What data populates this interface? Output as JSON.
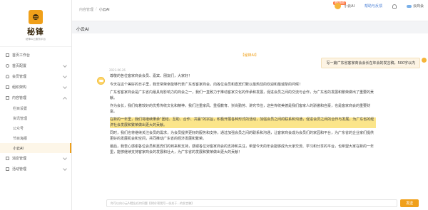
{
  "brand": {
    "title": "秘锋",
    "subtitle": "秘锋AI云服务平台"
  },
  "sidebar": {
    "items": [
      {
        "label": "首页工作台",
        "type": "item"
      },
      {
        "label": "首页配置",
        "type": "expandable"
      },
      {
        "label": "会员管理",
        "type": "expandable"
      },
      {
        "label": "组织架构",
        "type": "expandable"
      },
      {
        "label": "内容管理",
        "type": "expanded"
      },
      {
        "label": "栏目设置",
        "type": "sub"
      },
      {
        "label": "资讯管理",
        "type": "sub"
      },
      {
        "label": "公众号",
        "type": "sub"
      },
      {
        "label": "节目海报",
        "type": "sub"
      },
      {
        "label": "小云AI",
        "type": "sub-active"
      },
      {
        "label": "消息管理",
        "type": "expandable"
      },
      {
        "label": "活动管理",
        "type": "expandable"
      }
    ]
  },
  "topbar": {
    "breadcrumb": [
      "内容管理",
      "小云AI"
    ],
    "new_badge": "限时免费",
    "ai_label": "小云AI",
    "help_label": "帮助与反馈",
    "user_label": "云商会"
  },
  "page": {
    "title": "小云AI"
  },
  "chat": {
    "tag": "【秘锋AI】",
    "user_message": "写一篇广东省客家商会会长在年会的发言稿，500字以内",
    "time": "2023.06.26",
    "reply": [
      "尊敬的各位客家商会会员、嘉宾、朋友们，大家好！",
      "今天在这个美好的日子里，我非常荣幸能够代表广东省客家商会，向各位会员和嘉宾们致以最热忱的欢迎和最诚挚的问候！",
      "广东省客家商会是广东省内最具有影响力的商会之一，我们一直致力于推动客家文化的传承和发展，促进会员之间的交流与合作，为广东省的发展和繁荣做出了重要的贡献。",
      "作为会长，我们有着较好的优秀传统文化和精神，我们注重家风、重视教育、崇尚勤劳、讲究节俭，这些传统美德是我们客家人的骄傲和自豪，也是客家商会的重要财富。",
      "在新的一年里，我们将继续秉承“团结、互助、合作、共赢”的宗旨，积极开展各种形式的活动，加强会员之间的联系和沟通，促进会员之间的合作与发展，为广东省的经济社会发展和繁荣做出更大的贡献。",
      "同时，我们也将继续关注会员的需求，为会员提供更好的服务和支持，通过加强会员之间的联系和沟通，让客家商会成为会员们的家园和平台，为广东省的企业家们提供更好的发展机会和空间，共同推动广东省的经济发展和繁荣。",
      "最后，我衷心感谢各位会员和嘉宾们的到来和支持，感谢各位对客家商会的支持和关注，希望今天的年会能够成为大家交流、学习和分享的平台，也希望大家在新的一年里，能够继续支持客家商会的发展和壮大，为广东省的发展和繁荣做出更大的贡献！"
    ],
    "highlight_index": 4
  },
  "input": {
    "placeholder": "你可以向小云AI提出任何问题【例如:帮我写一份关于...的发言稿】",
    "send_label": "发送"
  },
  "colors": {
    "accent": "#f0a01a",
    "highlight": "#fbe58a"
  }
}
